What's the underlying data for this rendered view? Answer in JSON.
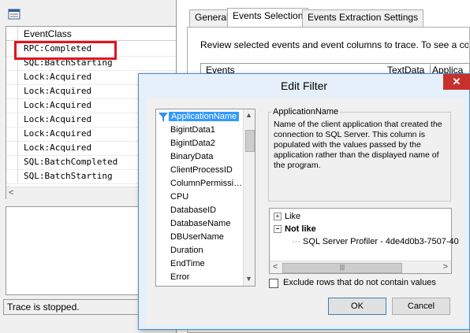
{
  "left_pane": {
    "grid": {
      "column_header": "EventClass",
      "rows": [
        "RPC:Completed",
        "SQL:BatchStarting",
        "Lock:Acquired",
        "Lock:Acquired",
        "Lock:Acquired",
        "Lock:Acquired",
        "Lock:Acquired",
        "Lock:Acquired",
        "SQL:BatchCompleted",
        "SQL:BatchStarting"
      ]
    },
    "status_text": "Trace is stopped."
  },
  "tabs": [
    "General",
    "Events Selection",
    "Events Extraction Settings"
  ],
  "active_tab": "Events Selection",
  "events_selection": {
    "review_text": "Review selected events and event columns to trace. To see a comple",
    "columns": [
      "Events",
      "TextData",
      "Applica"
    ]
  },
  "edit_filter": {
    "title": "Edit Filter",
    "close_glyph": "✕",
    "columns": [
      "ApplicationName",
      "BigintData1",
      "BigintData2",
      "BinaryData",
      "ClientProcessID",
      "ColumnPermissi…",
      "CPU",
      "DatabaseID",
      "DatabaseName",
      "DBUserName",
      "Duration",
      "EndTime",
      "Error"
    ],
    "selected_column": "ApplicationName",
    "description_title": "ApplicationName",
    "description": "Name of the client application that created the connection to SQL Server. This column is populated with the values passed by the application rather than the displayed name of the program.",
    "tree": {
      "like_label": "Like",
      "not_like_label": "Not like",
      "not_like_value": "SQL Server Profiler - 4de4d0b3-7507-40"
    },
    "exclude_label": "Exclude rows that do not contain values",
    "ok_label": "OK",
    "cancel_label": "Cancel"
  },
  "colors": {
    "highlight_border": "#e0141f",
    "selection": "#3399ff",
    "close_button": "#c7302c",
    "dialog_frame": "#4a8ad4"
  }
}
